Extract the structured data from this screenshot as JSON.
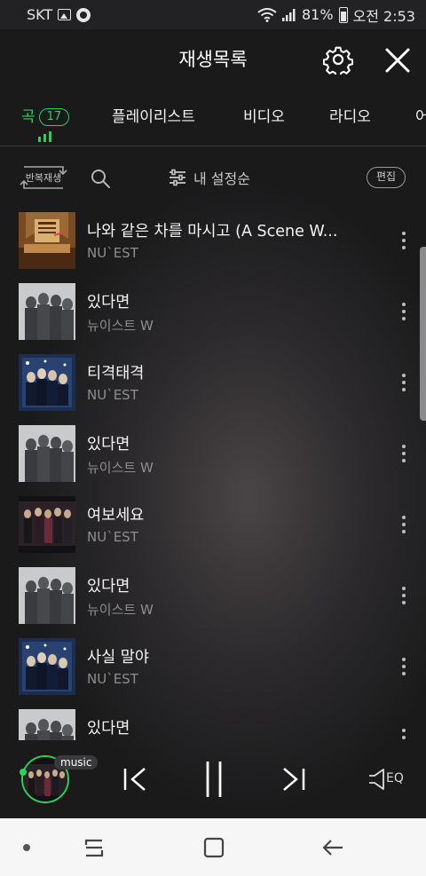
{
  "status_bar": {
    "carrier": "SKT",
    "battery": "81%",
    "time": "오전 2:53"
  },
  "header": {
    "title": "재생목록",
    "settings_icon": "gear-icon",
    "close_icon": "close-icon"
  },
  "tabs": [
    {
      "label": "곡",
      "badge": "17",
      "active": true
    },
    {
      "label": "플레이리스트",
      "active": false
    },
    {
      "label": "비디오",
      "active": false
    },
    {
      "label": "라디오",
      "active": false
    },
    {
      "label": "어",
      "active": false
    }
  ],
  "toolbar": {
    "repeat_label": "반복재생",
    "sort_label": "내 설정순",
    "edit_label": "편집"
  },
  "songs": [
    {
      "title": "나와 같은 차를 마시고 (A Scene W...",
      "artist": "NU`EST"
    },
    {
      "title": "있다면",
      "artist": "뉴이스트 W"
    },
    {
      "title": "티격태격",
      "artist": "NU`EST"
    },
    {
      "title": "있다면",
      "artist": "뉴이스트 W"
    },
    {
      "title": "여보세요",
      "artist": "NU`EST"
    },
    {
      "title": "있다면",
      "artist": "뉴이스트 W"
    },
    {
      "title": "사실 말야",
      "artist": "NU`EST"
    },
    {
      "title": "있다면",
      "artist": ""
    }
  ],
  "player": {
    "tag": "music",
    "eq_label": "EQ"
  },
  "colors": {
    "accent": "#2ed158",
    "background": "#1b1b1c",
    "navbar": "#f6f6f6"
  }
}
